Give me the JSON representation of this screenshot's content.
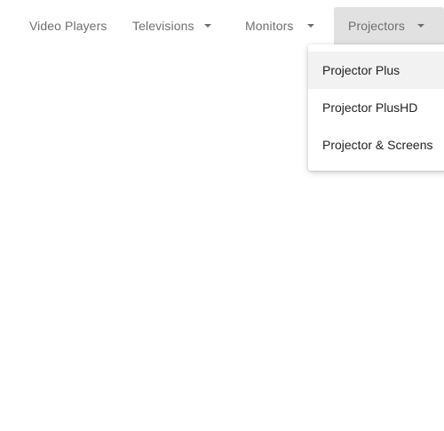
{
  "menubar": {
    "items": [
      {
        "label": "Video Players"
      },
      {
        "label": "Televisions"
      },
      {
        "label": "Monitors"
      },
      {
        "label": "Projectors"
      }
    ]
  },
  "dropdown": {
    "items": [
      {
        "label": "Projector Plus",
        "highlighted": true
      },
      {
        "label": "Projector PlusHD"
      },
      {
        "label": "Projector & Screens"
      }
    ]
  },
  "colors": {
    "menu_text": "#6f6f6f",
    "active_menu_bg": "#e1e1e1",
    "dropdown_text": "#222222",
    "hover_bg": "#f2f2f2"
  },
  "icons": {
    "dropdown_indicator": "caret-down-icon"
  }
}
